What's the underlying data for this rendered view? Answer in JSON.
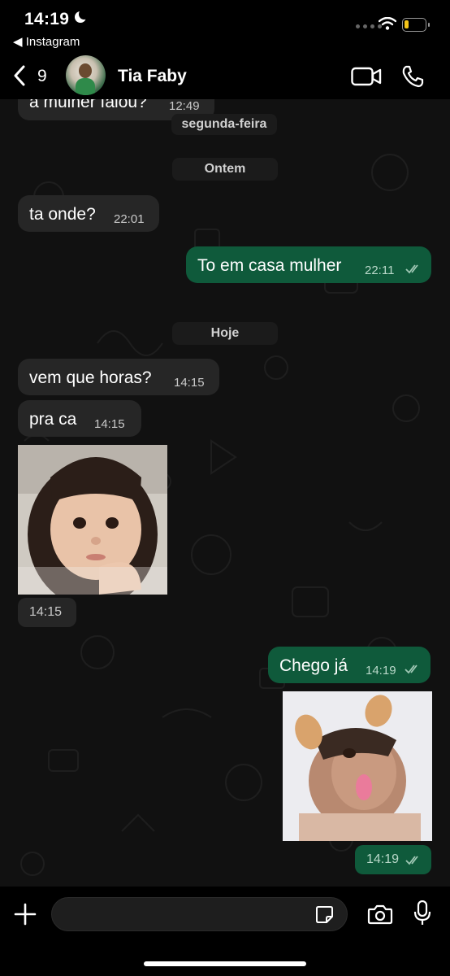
{
  "status_bar": {
    "time": "14:19",
    "back_app": "◀ Instagram"
  },
  "header": {
    "back_count": "9",
    "contact_name": "Tia Faby"
  },
  "messages": {
    "m0": {
      "text": "a mulher falou?",
      "time": "12:49"
    },
    "d1": {
      "label": "segunda-feira"
    },
    "d2": {
      "label": "Ontem"
    },
    "m1": {
      "text": "ta onde?",
      "time": "22:01"
    },
    "m2": {
      "text": "To em casa mulher",
      "time": "22:11"
    },
    "d3": {
      "label": "Hoje"
    },
    "m3": {
      "text": "vem que horas?",
      "time": "14:15"
    },
    "m4": {
      "text": "pra ca",
      "time": "14:15"
    },
    "m5": {
      "time": "14:15"
    },
    "m6": {
      "text": "Chego já",
      "time": "14:19"
    },
    "m7": {
      "time": "14:19"
    }
  },
  "input": {
    "placeholder": ""
  },
  "colors": {
    "incoming_bubble": "#262626",
    "outgoing_bubble": "#0f5a3b",
    "background": "#111111"
  },
  "icons": [
    "back-arrow",
    "video-camera",
    "phone",
    "plus",
    "sticker",
    "camera",
    "microphone",
    "double-check"
  ]
}
